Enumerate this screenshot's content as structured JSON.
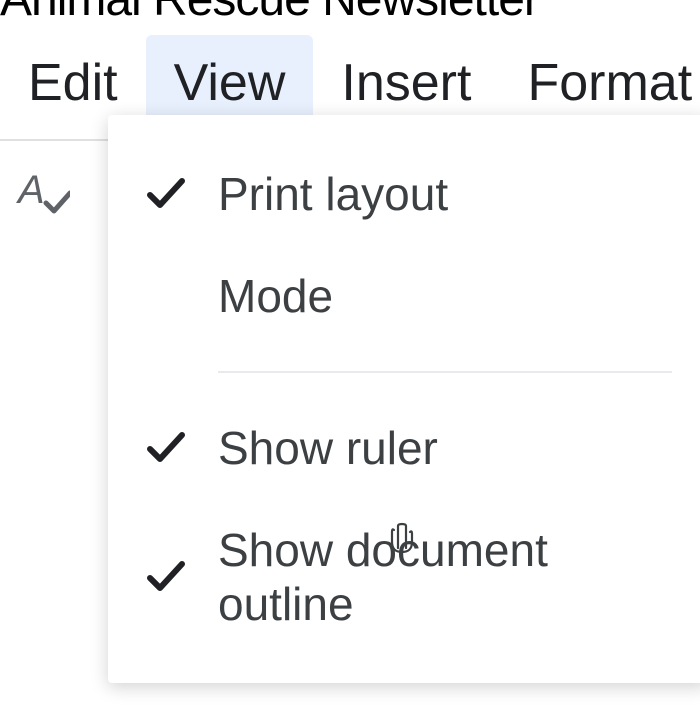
{
  "document": {
    "title": "Animal Rescue Newsletter"
  },
  "menu": {
    "items": [
      "Edit",
      "View",
      "Insert",
      "Format"
    ],
    "active_index": 1
  },
  "toolbar": {
    "icons": [
      "spellcheck"
    ]
  },
  "view_dropdown": {
    "items": [
      {
        "label": "Print layout",
        "checked": true
      },
      {
        "label": "Mode",
        "checked": false
      },
      {
        "divider": true
      },
      {
        "label": "Show ruler",
        "checked": true
      },
      {
        "label": "Show document outline",
        "checked": true
      }
    ]
  }
}
